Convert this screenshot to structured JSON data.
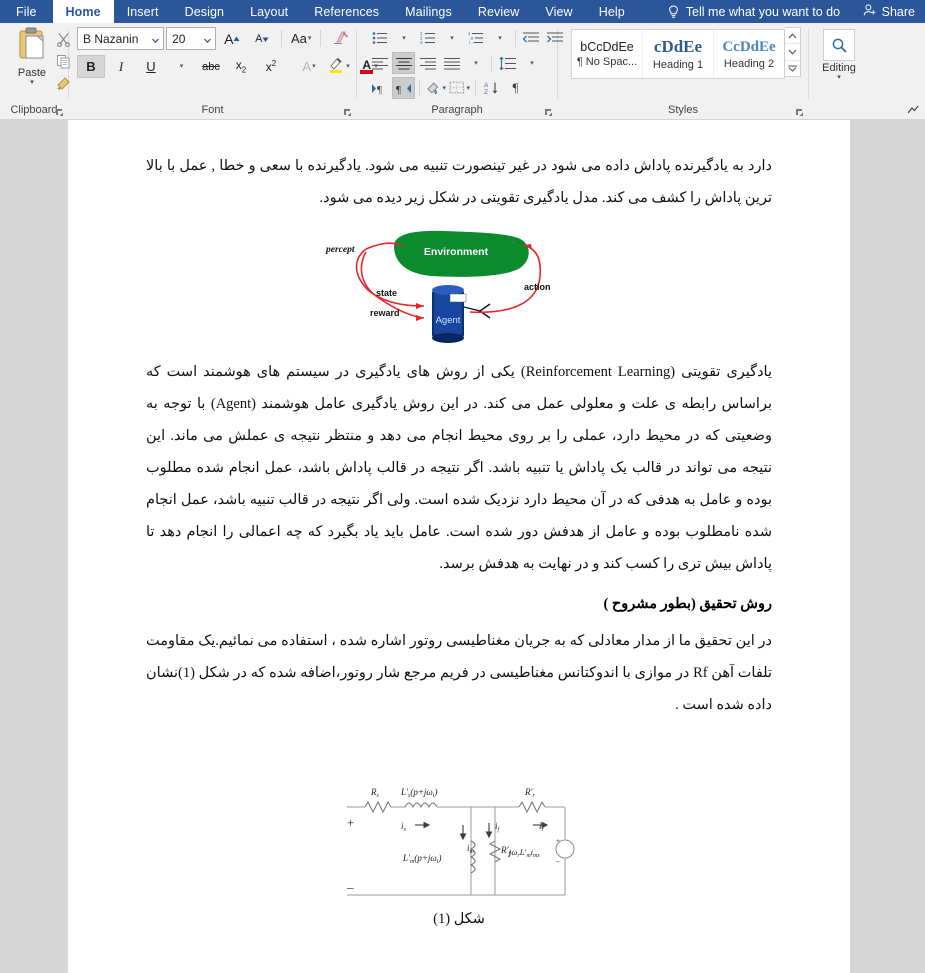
{
  "window": {
    "ribbon_tabs": [
      {
        "label": "File",
        "active": false
      },
      {
        "label": "Home",
        "active": true
      },
      {
        "label": "Insert",
        "active": false
      },
      {
        "label": "Design",
        "active": false
      },
      {
        "label": "Layout",
        "active": false
      },
      {
        "label": "References",
        "active": false
      },
      {
        "label": "Mailings",
        "active": false
      },
      {
        "label": "Review",
        "active": false
      },
      {
        "label": "View",
        "active": false
      },
      {
        "label": "Help",
        "active": false
      }
    ],
    "tell_me": "Tell me what you want to do",
    "share": "Share",
    "accent_color": "#2b579a",
    "ribbon_bg": "#f1f1f1"
  },
  "ribbon": {
    "clipboard": {
      "group_label": "Clipboard",
      "paste_label": "Paste",
      "cut_label": "Cut",
      "copy_label": "Copy",
      "format_painter_label": "Format Painter"
    },
    "font": {
      "group_label": "Font",
      "font_name": "B Nazanin",
      "font_size": "20",
      "grow_font_label": "A",
      "shrink_font_label": "A",
      "change_case_label": "Aa",
      "bold_label": "B",
      "italic_label": "I",
      "underline_label": "U",
      "strikethrough_label": "abc",
      "subscript_label": "x",
      "subscript_sup": "2",
      "superscript_label": "x",
      "superscript_sup": "2",
      "text_effects_label": "A",
      "highlight_label": "ab",
      "font_color_label": "A",
      "highlight_color": "#ffe600",
      "font_color": "#d0021b"
    },
    "paragraph": {
      "group_label": "Paragraph"
    },
    "styles": {
      "group_label": "Styles",
      "items": [
        {
          "sample": "bCcDdEe",
          "name": "¶ No Spac...",
          "kind": "plain"
        },
        {
          "sample": "cDdEe",
          "name": "Heading 1",
          "kind": "h1"
        },
        {
          "sample": "CcDdEe",
          "name": "Heading 2",
          "kind": "h2"
        }
      ]
    },
    "editing": {
      "group_label": "Editing",
      "button_label": "Editing"
    }
  },
  "document": {
    "paragraphs": [
      "دارد به یادگیرنده پاداش داده می شود در غیر تینصورت تنبیه می شود. یادگیرنده با سعی و خطا , عمل با بالا ترین پاداش را کشف می کند. مدل یادگیری تقویتی در شکل زیر دیده می شود.",
      "یادگیری تقویتی (Reinforcement Learning) یکی از روش های یادگیری در سیستم های هوشمند است که براساس رابطه ی علت و معلولی عمل می کند. در این روش یادگیری عامل هوشمند (Agent) با توجه به وضعیتی که در محیط دارد، عملی را بر روی محیط انجام می دهد و منتظر نتیجه ی عملش می ماند. این نتیجه می تواند در قالب یک پاداش یا تنبیه باشد. اگر نتیجه در قالب پاداش باشد، عمل انجام شده مطلوب بوده و عامل به هدفی که در آن محیط دارد نزدیک شده است. ولی اگر نتیجه در قالب تنبیه باشد، عمل انجام شده نامطلوب بوده و عامل از هدفش دور شده است. عامل باید یاد بگیرد که چه اعمالی را انجام دهد تا پاداش بیش تری را کسب کند و در نهایت به هدفش برسد.",
      "در این تحقیق ما از مدار معادلی که به جریان مغناطیسی روتور اشاره شده ، استفاده می نمائیم.یک مقاومت تلفات آهن Rf در موازی با اندوکتانس مغناطیسی در فریم مرجع شار روتور،اضافه شده که در شکل (1)نشان داده شده است ."
    ],
    "heading": "روش تحقیق (بطور مشروح )",
    "caption": "شکل (1)"
  },
  "rl_figure": {
    "environment_label": "Environment",
    "agent_label": "Agent",
    "percept_label": "percept",
    "state_label": "state",
    "reward_label": "reward",
    "action_label": "action",
    "env_color": "#0b8a2e",
    "agent_color": "#1a3f8f",
    "arrow_color": "#e8252a"
  },
  "circuit_figure": {
    "labels": {
      "rs": "R",
      "rs_sub": "s",
      "ls": "L′ (p+jω )",
      "is": "i",
      "is_sub": "s",
      "lm": "L′ (p+jω )",
      "im": "i",
      "im_sub": "m",
      "if": "i",
      "if_sub": "f",
      "rf": "R′",
      "rf_sub": "f",
      "rr": "R′",
      "rr_sub": "r",
      "ir": "i",
      "ir_sub": "r",
      "source": "jω L′ i",
      "plus": "+",
      "minus": "−"
    }
  }
}
